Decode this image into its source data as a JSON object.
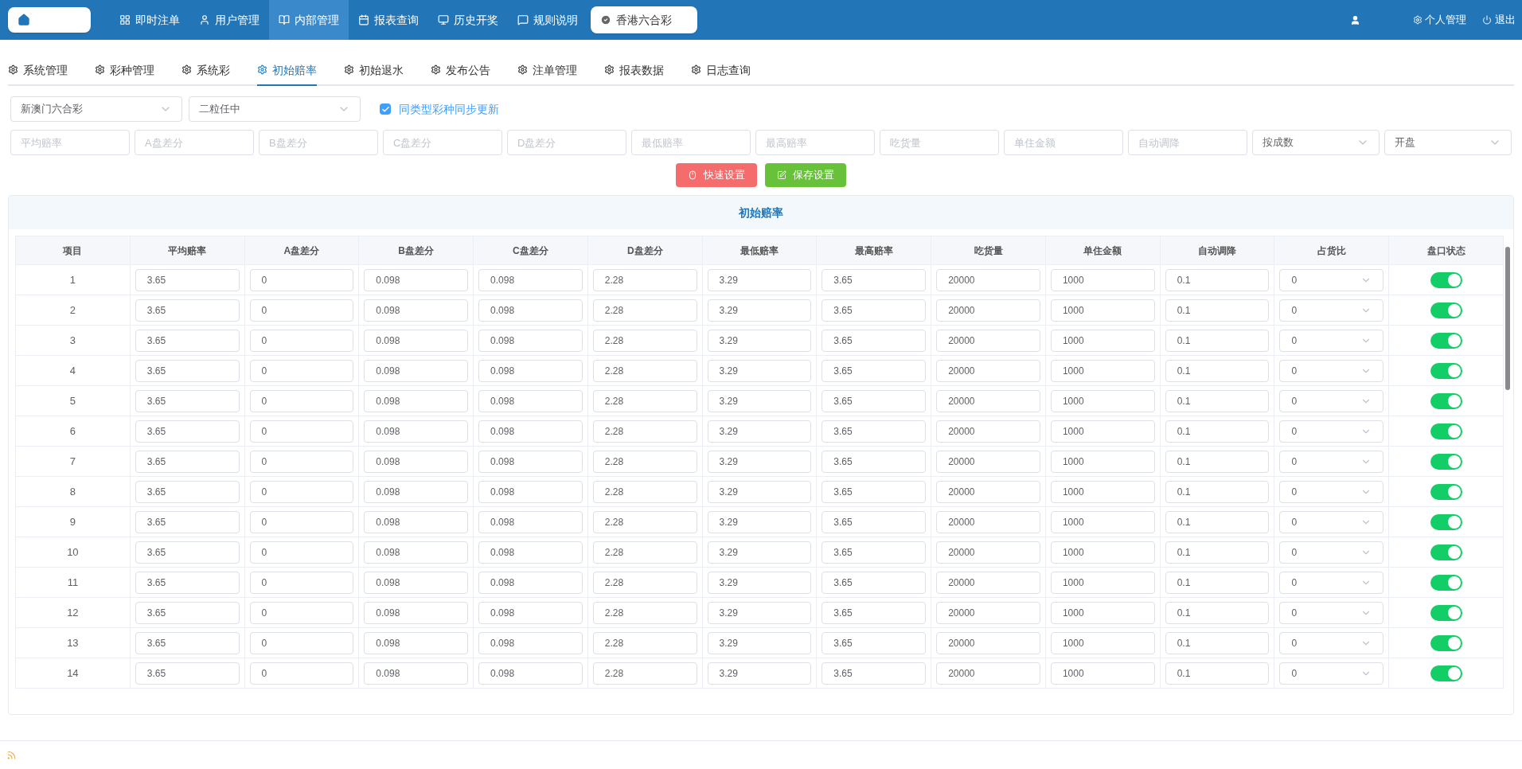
{
  "nav": {
    "items": [
      {
        "label": "即时注单",
        "selected": false
      },
      {
        "label": "用户管理",
        "selected": false
      },
      {
        "label": "内部管理",
        "selected": true
      },
      {
        "label": "报表查询",
        "selected": false
      },
      {
        "label": "历史开奖",
        "selected": false
      },
      {
        "label": "规则说明",
        "selected": false
      }
    ],
    "lottery": "香港六合彩",
    "personal": "个人管理",
    "logout": "退出"
  },
  "tabs": [
    {
      "label": "系统管理",
      "selected": false
    },
    {
      "label": "彩种管理",
      "selected": false
    },
    {
      "label": "系统彩",
      "selected": false
    },
    {
      "label": "初始赔率",
      "selected": true
    },
    {
      "label": "初始退水",
      "selected": false
    },
    {
      "label": "发布公告",
      "selected": false
    },
    {
      "label": "注单管理",
      "selected": false
    },
    {
      "label": "报表数据",
      "selected": false
    },
    {
      "label": "日志查询",
      "selected": false
    }
  ],
  "filters": {
    "lottery_select": "新澳门六合彩",
    "play_select": "二粒任中",
    "sync": {
      "label": "同类型彩种同步更新",
      "checked": true
    },
    "fields": [
      {
        "placeholder": "平均赔率"
      },
      {
        "placeholder": "A盘差分"
      },
      {
        "placeholder": "B盘差分"
      },
      {
        "placeholder": "C盘差分"
      },
      {
        "placeholder": "D盘差分"
      },
      {
        "placeholder": "最低赔率"
      },
      {
        "placeholder": "最高赔率"
      },
      {
        "placeholder": "吃货量"
      },
      {
        "placeholder": "单住金额"
      },
      {
        "placeholder": "自动调降"
      }
    ],
    "mode_select": "按成数",
    "status_select": "开盘"
  },
  "buttons": [
    {
      "label": "快速设置",
      "kind": "quick"
    },
    {
      "label": "保存设置",
      "kind": "save"
    }
  ],
  "table": {
    "title": "初始赔率",
    "columns": [
      "项目",
      "平均赔率",
      "A盘差分",
      "B盘差分",
      "C盘差分",
      "D盘差分",
      "最低赔率",
      "最高赔率",
      "吃货量",
      "单住金额",
      "自动调降",
      "占货比",
      "盘口状态"
    ],
    "rows": [
      {
        "cells": [
          "1",
          "3.65",
          "0",
          "0.098",
          "0.098",
          "2.28",
          "3.29",
          "3.65",
          "20000",
          "1000",
          "0.1"
        ],
        "share": "0",
        "on": true
      },
      {
        "cells": [
          "2",
          "3.65",
          "0",
          "0.098",
          "0.098",
          "2.28",
          "3.29",
          "3.65",
          "20000",
          "1000",
          "0.1"
        ],
        "share": "0",
        "on": true
      },
      {
        "cells": [
          "3",
          "3.65",
          "0",
          "0.098",
          "0.098",
          "2.28",
          "3.29",
          "3.65",
          "20000",
          "1000",
          "0.1"
        ],
        "share": "0",
        "on": true
      },
      {
        "cells": [
          "4",
          "3.65",
          "0",
          "0.098",
          "0.098",
          "2.28",
          "3.29",
          "3.65",
          "20000",
          "1000",
          "0.1"
        ],
        "share": "0",
        "on": true
      },
      {
        "cells": [
          "5",
          "3.65",
          "0",
          "0.098",
          "0.098",
          "2.28",
          "3.29",
          "3.65",
          "20000",
          "1000",
          "0.1"
        ],
        "share": "0",
        "on": true
      },
      {
        "cells": [
          "6",
          "3.65",
          "0",
          "0.098",
          "0.098",
          "2.28",
          "3.29",
          "3.65",
          "20000",
          "1000",
          "0.1"
        ],
        "share": "0",
        "on": true
      },
      {
        "cells": [
          "7",
          "3.65",
          "0",
          "0.098",
          "0.098",
          "2.28",
          "3.29",
          "3.65",
          "20000",
          "1000",
          "0.1"
        ],
        "share": "0",
        "on": true
      },
      {
        "cells": [
          "8",
          "3.65",
          "0",
          "0.098",
          "0.098",
          "2.28",
          "3.29",
          "3.65",
          "20000",
          "1000",
          "0.1"
        ],
        "share": "0",
        "on": true
      },
      {
        "cells": [
          "9",
          "3.65",
          "0",
          "0.098",
          "0.098",
          "2.28",
          "3.29",
          "3.65",
          "20000",
          "1000",
          "0.1"
        ],
        "share": "0",
        "on": true
      },
      {
        "cells": [
          "10",
          "3.65",
          "0",
          "0.098",
          "0.098",
          "2.28",
          "3.29",
          "3.65",
          "20000",
          "1000",
          "0.1"
        ],
        "share": "0",
        "on": true
      },
      {
        "cells": [
          "11",
          "3.65",
          "0",
          "0.098",
          "0.098",
          "2.28",
          "3.29",
          "3.65",
          "20000",
          "1000",
          "0.1"
        ],
        "share": "0",
        "on": true
      },
      {
        "cells": [
          "12",
          "3.65",
          "0",
          "0.098",
          "0.098",
          "2.28",
          "3.29",
          "3.65",
          "20000",
          "1000",
          "0.1"
        ],
        "share": "0",
        "on": true
      },
      {
        "cells": [
          "13",
          "3.65",
          "0",
          "0.098",
          "0.098",
          "2.28",
          "3.29",
          "3.65",
          "20000",
          "1000",
          "0.1"
        ],
        "share": "0",
        "on": true
      },
      {
        "cells": [
          "14",
          "3.65",
          "0",
          "0.098",
          "0.098",
          "2.28",
          "3.29",
          "3.65",
          "20000",
          "1000",
          "0.1"
        ],
        "share": "0",
        "on": true
      }
    ]
  }
}
